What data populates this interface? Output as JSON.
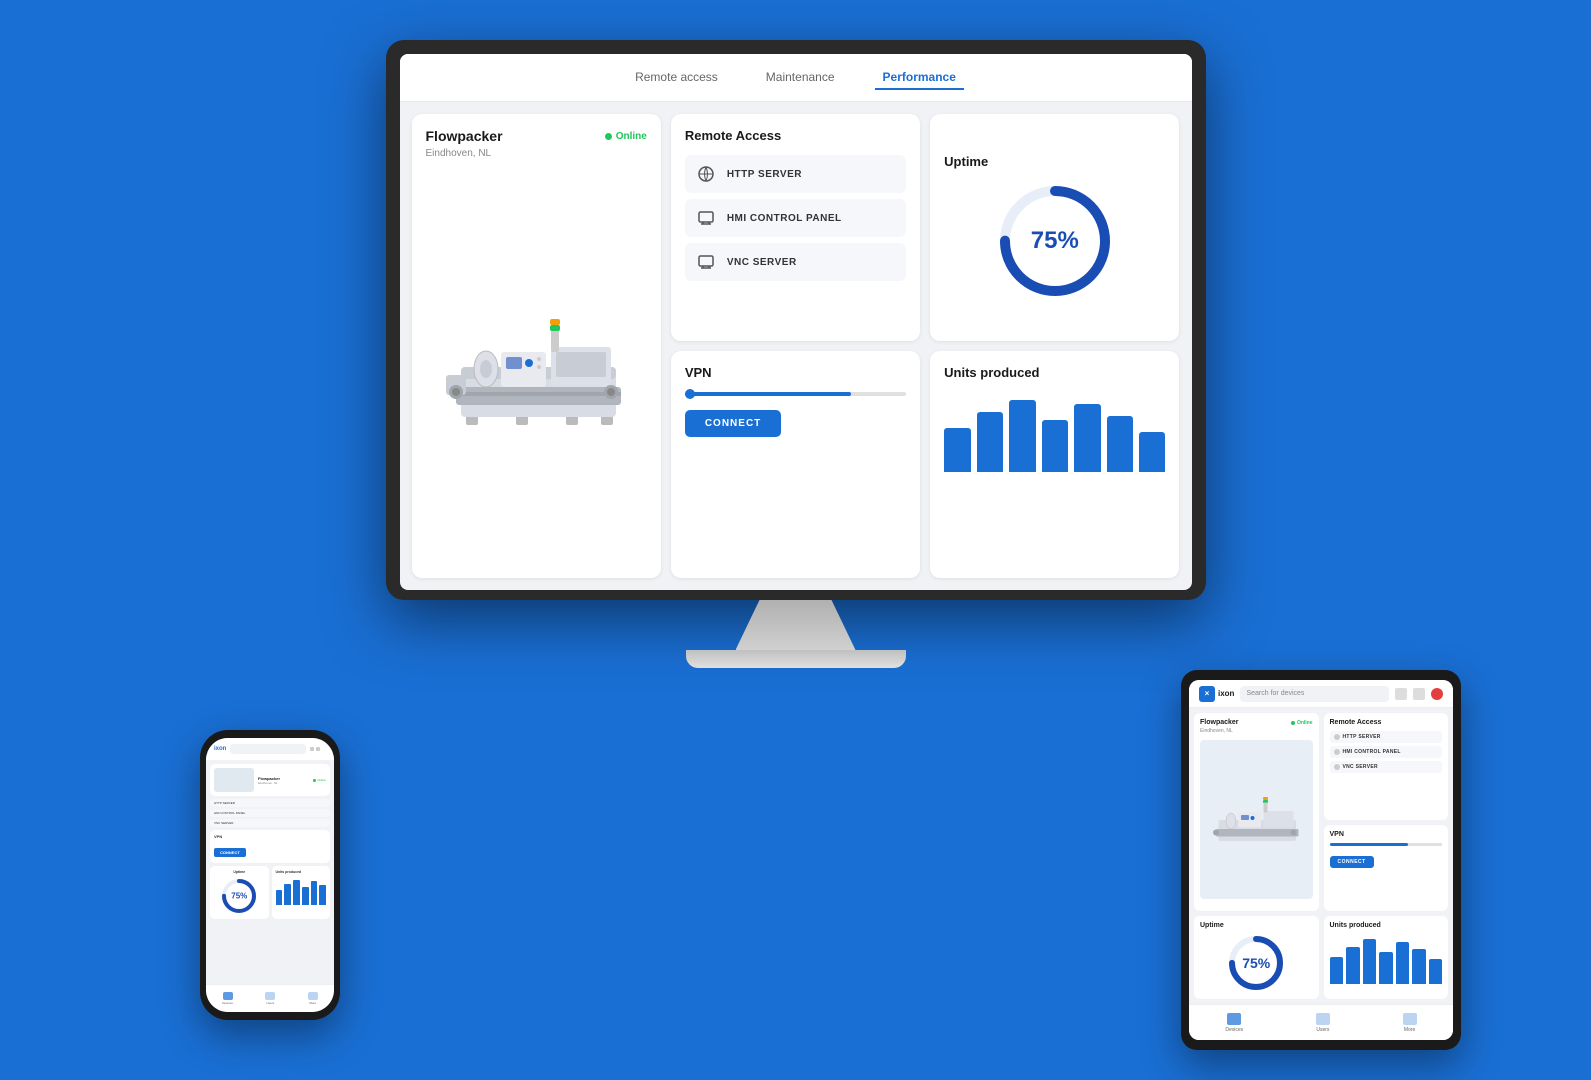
{
  "app": {
    "logo": "ixon",
    "tabs": [
      {
        "id": "remote-access",
        "label": "Remote access"
      },
      {
        "id": "maintenance",
        "label": "Maintenance"
      },
      {
        "id": "performance",
        "label": "Performance"
      }
    ],
    "active_tab": "performance"
  },
  "machine": {
    "name": "Flowpacker",
    "location": "Eindhoven, NL",
    "status": "Online"
  },
  "remote_access": {
    "title": "Remote Access",
    "services": [
      {
        "id": "http",
        "name": "HTTP SERVER",
        "icon": "⊕"
      },
      {
        "id": "hmi",
        "name": "HMI CONTROL PANEL",
        "icon": "⊟"
      },
      {
        "id": "vnc",
        "name": "VNC SERVER",
        "icon": "⊟"
      }
    ]
  },
  "uptime": {
    "title": "Uptime",
    "value": 75,
    "label": "75%"
  },
  "vpn": {
    "title": "VPN",
    "connect_label": "CONNECT"
  },
  "units_produced": {
    "title": "Units produced",
    "bars": [
      55,
      75,
      90,
      65,
      85,
      70,
      50
    ]
  },
  "phone": {
    "search_placeholder": "Search for devices"
  },
  "tablet": {
    "search_placeholder": "Search for devices"
  }
}
